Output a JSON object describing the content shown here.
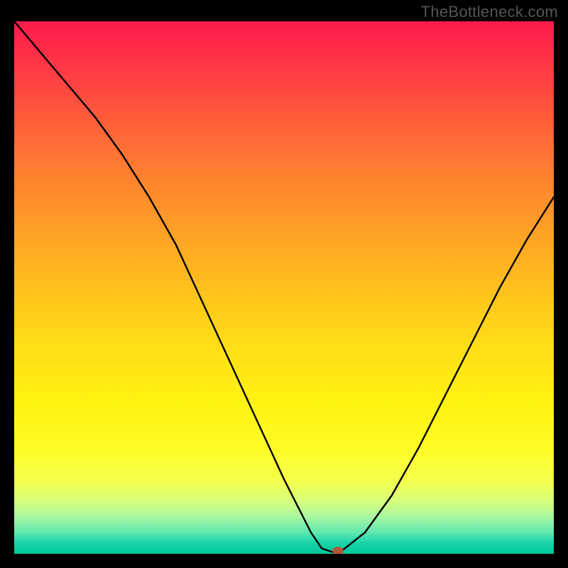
{
  "watermark": "TheBottleneck.com",
  "chart_data": {
    "type": "line",
    "title": "",
    "xlabel": "",
    "ylabel": "",
    "xlim": [
      0,
      100
    ],
    "ylim": [
      0,
      100
    ],
    "grid": false,
    "legend": false,
    "background": "red-yellow-green vertical gradient",
    "series": [
      {
        "name": "bottleneck-curve",
        "x": [
          0,
          5,
          10,
          15,
          20,
          25,
          30,
          35,
          40,
          45,
          50,
          55,
          57,
          60,
          65,
          70,
          75,
          80,
          85,
          90,
          95,
          100
        ],
        "y": [
          100,
          94,
          88,
          82,
          75,
          67,
          58,
          47,
          36,
          25,
          14,
          4,
          1,
          0,
          4,
          11,
          20,
          30,
          40,
          50,
          59,
          67
        ]
      }
    ],
    "marker": {
      "name": "optimal-point",
      "x": 60,
      "y": 0,
      "color": "#b4573a"
    }
  }
}
